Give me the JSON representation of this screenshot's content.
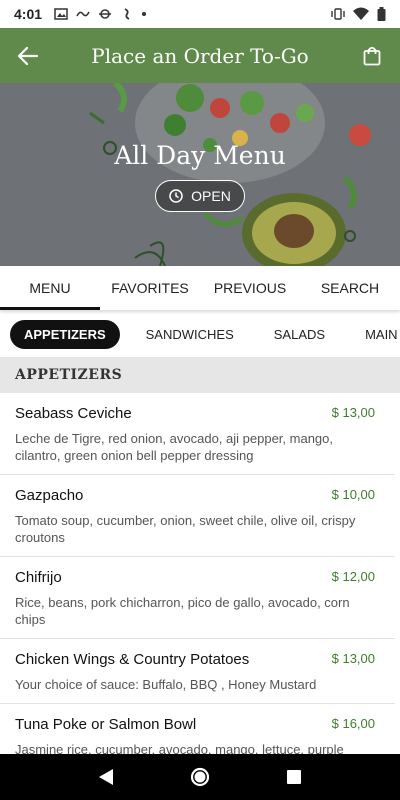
{
  "status": {
    "time": "4:01"
  },
  "app_bar": {
    "title": "Place an Order To-Go",
    "back_icon": "arrow-left-icon",
    "cart_icon": "shopping-bag-icon",
    "color": "#5f8a4b"
  },
  "hero": {
    "title": "All Day Menu",
    "open_label": "OPEN"
  },
  "tabs": [
    {
      "label": "MENU",
      "active": true
    },
    {
      "label": "FAVORITES",
      "active": false
    },
    {
      "label": "PREVIOUS",
      "active": false
    },
    {
      "label": "SEARCH",
      "active": false
    }
  ],
  "categories": [
    {
      "label": "APPETIZERS",
      "active": true
    },
    {
      "label": "SANDWICHES",
      "active": false
    },
    {
      "label": "SALADS",
      "active": false
    },
    {
      "label": "MAIN COU",
      "active": false
    }
  ],
  "section": {
    "title": "APPETIZERS"
  },
  "items": [
    {
      "name": "Seabass Ceviche",
      "price": "$ 13,00",
      "description": "Leche de Tigre, red onion, avocado, aji pepper, mango, cilantro, green onion bell pepper dressing"
    },
    {
      "name": "Gazpacho",
      "price": "$ 10,00",
      "description": "Tomato soup, cucumber, onion, sweet chile, olive oil, crispy croutons"
    },
    {
      "name": "Chifrijo",
      "price": "$ 12,00",
      "description": "Rice, beans, pork chicharron, pico de gallo, avocado, corn chips"
    },
    {
      "name": "Chicken Wings & Country Potatoes",
      "price": "$ 13,00",
      "description": "Your choice of sauce: Buffalo, BBQ , Honey Mustard"
    },
    {
      "name": "Tuna Poke or Salmon Bowl",
      "price": "$ 16,00",
      "description": "Jasmine rice, cucumber, avocado, mango, lettuce, purple"
    }
  ],
  "colors": {
    "price": "#3f7d2d",
    "accent": "#5f8a4b"
  }
}
